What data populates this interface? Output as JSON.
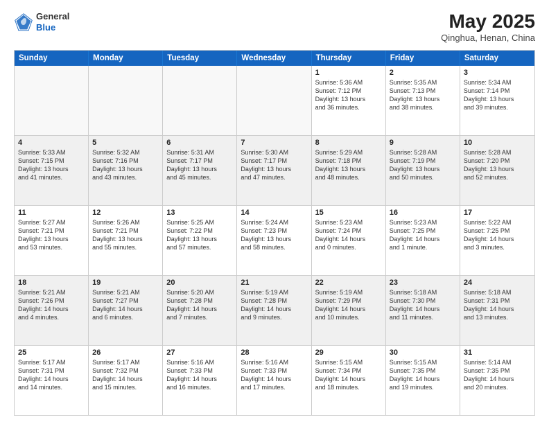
{
  "header": {
    "logo": {
      "line1": "General",
      "line2": "Blue"
    },
    "title": "May 2025",
    "location": "Qinghua, Henan, China"
  },
  "days_of_week": [
    "Sunday",
    "Monday",
    "Tuesday",
    "Wednesday",
    "Thursday",
    "Friday",
    "Saturday"
  ],
  "weeks": [
    [
      {
        "day": "",
        "info": ""
      },
      {
        "day": "",
        "info": ""
      },
      {
        "day": "",
        "info": ""
      },
      {
        "day": "",
        "info": ""
      },
      {
        "day": "1",
        "info": "Sunrise: 5:36 AM\nSunset: 7:12 PM\nDaylight: 13 hours\nand 36 minutes."
      },
      {
        "day": "2",
        "info": "Sunrise: 5:35 AM\nSunset: 7:13 PM\nDaylight: 13 hours\nand 38 minutes."
      },
      {
        "day": "3",
        "info": "Sunrise: 5:34 AM\nSunset: 7:14 PM\nDaylight: 13 hours\nand 39 minutes."
      }
    ],
    [
      {
        "day": "4",
        "info": "Sunrise: 5:33 AM\nSunset: 7:15 PM\nDaylight: 13 hours\nand 41 minutes."
      },
      {
        "day": "5",
        "info": "Sunrise: 5:32 AM\nSunset: 7:16 PM\nDaylight: 13 hours\nand 43 minutes."
      },
      {
        "day": "6",
        "info": "Sunrise: 5:31 AM\nSunset: 7:17 PM\nDaylight: 13 hours\nand 45 minutes."
      },
      {
        "day": "7",
        "info": "Sunrise: 5:30 AM\nSunset: 7:17 PM\nDaylight: 13 hours\nand 47 minutes."
      },
      {
        "day": "8",
        "info": "Sunrise: 5:29 AM\nSunset: 7:18 PM\nDaylight: 13 hours\nand 48 minutes."
      },
      {
        "day": "9",
        "info": "Sunrise: 5:28 AM\nSunset: 7:19 PM\nDaylight: 13 hours\nand 50 minutes."
      },
      {
        "day": "10",
        "info": "Sunrise: 5:28 AM\nSunset: 7:20 PM\nDaylight: 13 hours\nand 52 minutes."
      }
    ],
    [
      {
        "day": "11",
        "info": "Sunrise: 5:27 AM\nSunset: 7:21 PM\nDaylight: 13 hours\nand 53 minutes."
      },
      {
        "day": "12",
        "info": "Sunrise: 5:26 AM\nSunset: 7:21 PM\nDaylight: 13 hours\nand 55 minutes."
      },
      {
        "day": "13",
        "info": "Sunrise: 5:25 AM\nSunset: 7:22 PM\nDaylight: 13 hours\nand 57 minutes."
      },
      {
        "day": "14",
        "info": "Sunrise: 5:24 AM\nSunset: 7:23 PM\nDaylight: 13 hours\nand 58 minutes."
      },
      {
        "day": "15",
        "info": "Sunrise: 5:23 AM\nSunset: 7:24 PM\nDaylight: 14 hours\nand 0 minutes."
      },
      {
        "day": "16",
        "info": "Sunrise: 5:23 AM\nSunset: 7:25 PM\nDaylight: 14 hours\nand 1 minute."
      },
      {
        "day": "17",
        "info": "Sunrise: 5:22 AM\nSunset: 7:25 PM\nDaylight: 14 hours\nand 3 minutes."
      }
    ],
    [
      {
        "day": "18",
        "info": "Sunrise: 5:21 AM\nSunset: 7:26 PM\nDaylight: 14 hours\nand 4 minutes."
      },
      {
        "day": "19",
        "info": "Sunrise: 5:21 AM\nSunset: 7:27 PM\nDaylight: 14 hours\nand 6 minutes."
      },
      {
        "day": "20",
        "info": "Sunrise: 5:20 AM\nSunset: 7:28 PM\nDaylight: 14 hours\nand 7 minutes."
      },
      {
        "day": "21",
        "info": "Sunrise: 5:19 AM\nSunset: 7:28 PM\nDaylight: 14 hours\nand 9 minutes."
      },
      {
        "day": "22",
        "info": "Sunrise: 5:19 AM\nSunset: 7:29 PM\nDaylight: 14 hours\nand 10 minutes."
      },
      {
        "day": "23",
        "info": "Sunrise: 5:18 AM\nSunset: 7:30 PM\nDaylight: 14 hours\nand 11 minutes."
      },
      {
        "day": "24",
        "info": "Sunrise: 5:18 AM\nSunset: 7:31 PM\nDaylight: 14 hours\nand 13 minutes."
      }
    ],
    [
      {
        "day": "25",
        "info": "Sunrise: 5:17 AM\nSunset: 7:31 PM\nDaylight: 14 hours\nand 14 minutes."
      },
      {
        "day": "26",
        "info": "Sunrise: 5:17 AM\nSunset: 7:32 PM\nDaylight: 14 hours\nand 15 minutes."
      },
      {
        "day": "27",
        "info": "Sunrise: 5:16 AM\nSunset: 7:33 PM\nDaylight: 14 hours\nand 16 minutes."
      },
      {
        "day": "28",
        "info": "Sunrise: 5:16 AM\nSunset: 7:33 PM\nDaylight: 14 hours\nand 17 minutes."
      },
      {
        "day": "29",
        "info": "Sunrise: 5:15 AM\nSunset: 7:34 PM\nDaylight: 14 hours\nand 18 minutes."
      },
      {
        "day": "30",
        "info": "Sunrise: 5:15 AM\nSunset: 7:35 PM\nDaylight: 14 hours\nand 19 minutes."
      },
      {
        "day": "31",
        "info": "Sunrise: 5:14 AM\nSunset: 7:35 PM\nDaylight: 14 hours\nand 20 minutes."
      }
    ]
  ]
}
